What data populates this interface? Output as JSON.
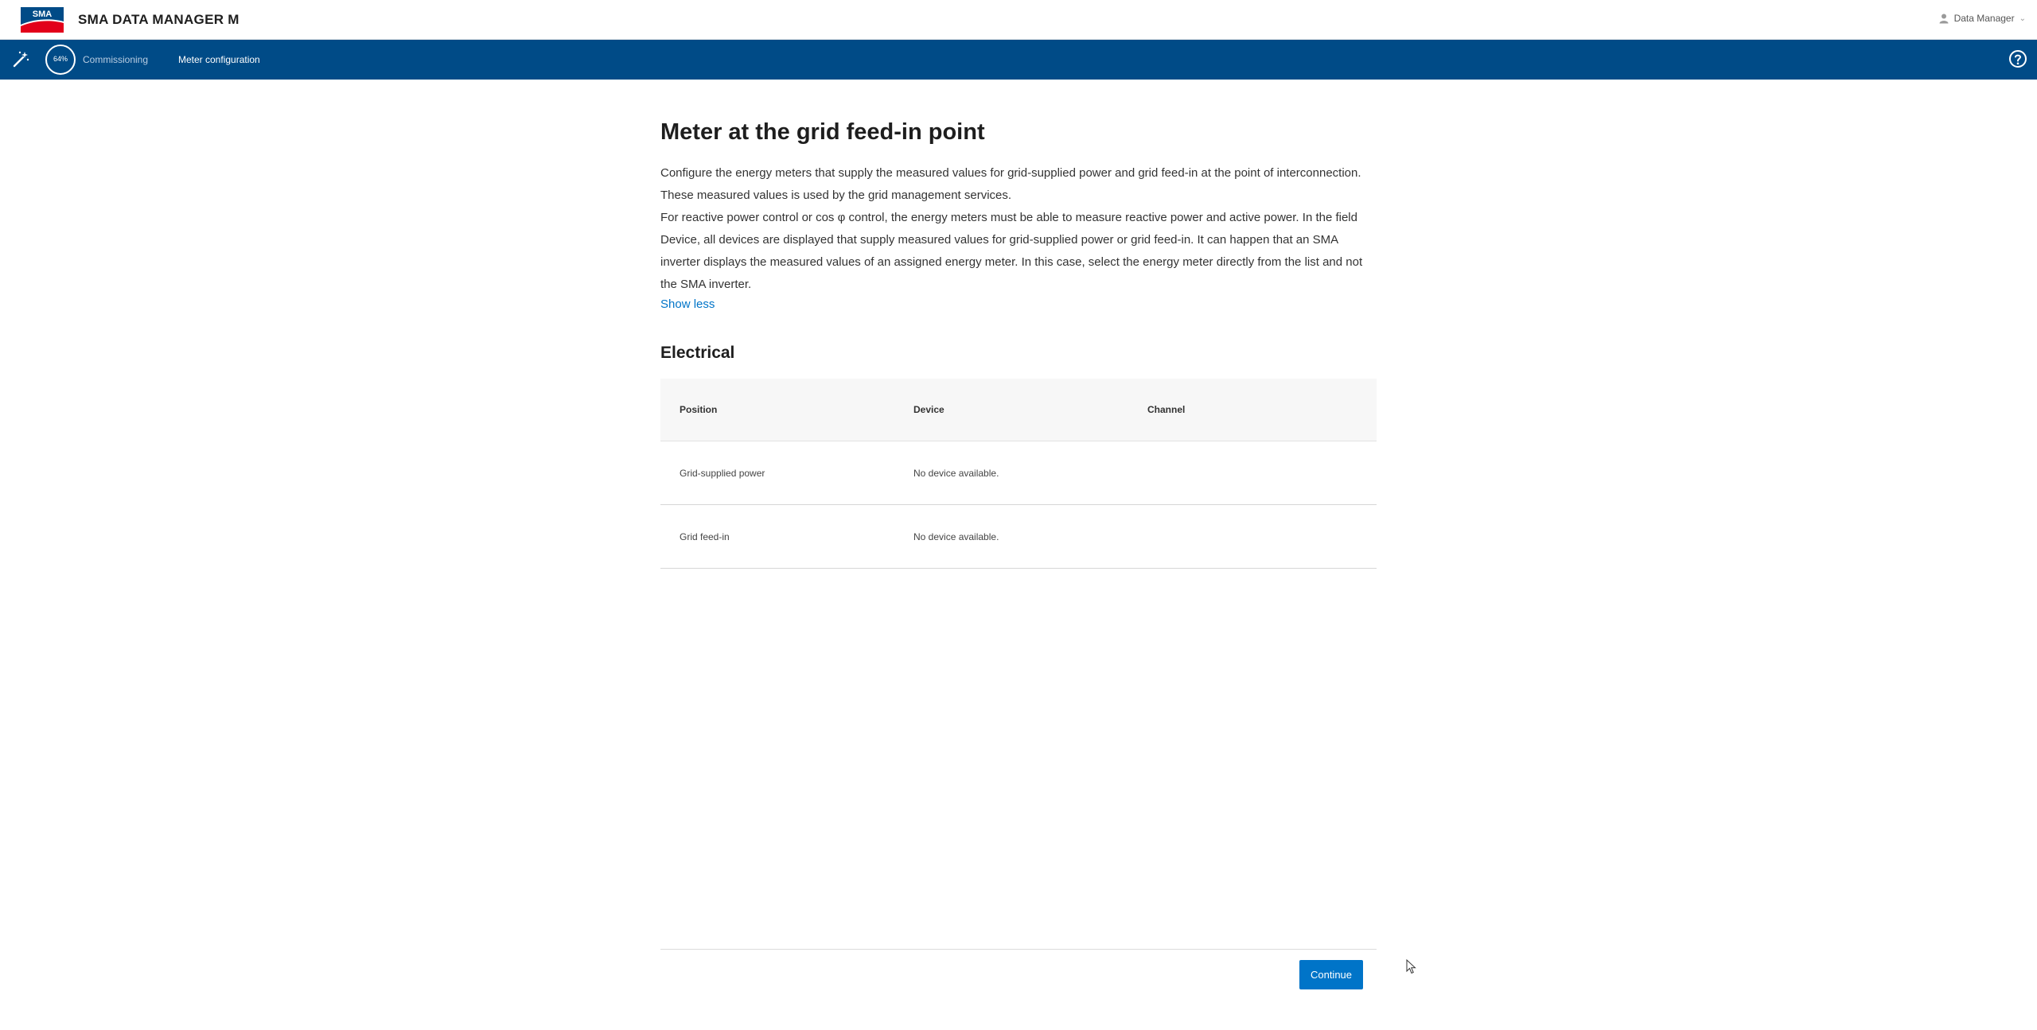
{
  "header": {
    "logo_text": "SMA",
    "app_title": "SMA DATA MANAGER M",
    "user_label": "Data Manager"
  },
  "nav": {
    "progress": "64%",
    "crumbs": [
      "Commissioning",
      "Meter configuration"
    ]
  },
  "main": {
    "title": "Meter at the grid feed-in point",
    "description_1": "Configure the energy meters that supply the measured values for grid-supplied power and grid feed-in at the point of interconnection. These measured values is used by the grid management services.",
    "description_2": "For reactive power control or cos φ control, the energy meters must be able to measure reactive power and active power. In the field Device, all devices are displayed that supply measured values for grid-supplied power or grid feed-in. It can happen that an SMA inverter displays the measured values of an assigned energy meter. In this case, select the energy meter directly from the list and not the SMA inverter.",
    "show_less": "Show less",
    "section_title": "Electrical",
    "table": {
      "headers": [
        "Position",
        "Device",
        "Channel"
      ],
      "rows": [
        {
          "position": "Grid-supplied power",
          "device": "No device available.",
          "channel": ""
        },
        {
          "position": "Grid feed-in",
          "device": "No device available.",
          "channel": ""
        }
      ]
    }
  },
  "footer": {
    "continue_label": "Continue"
  },
  "colors": {
    "nav_bg": "#004b87",
    "accent": "#0074c8",
    "logo_red": "#e2001a"
  },
  "icons": [
    "sma-logo",
    "user-icon",
    "chevron-down-icon",
    "wand-icon",
    "help-icon",
    "cursor-icon"
  ]
}
